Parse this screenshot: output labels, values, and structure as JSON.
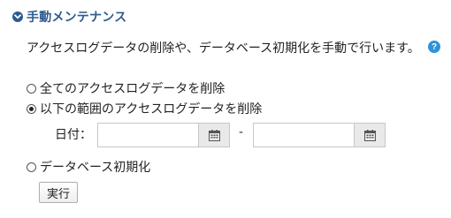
{
  "section": {
    "title": "手動メンテナンス",
    "description": "アクセスログデータの削除や、データベース初期化を手動で行います。",
    "help_label": "?"
  },
  "options": [
    {
      "label": "全てのアクセスログデータを削除",
      "checked": false
    },
    {
      "label": "以下の範囲のアクセスログデータを削除",
      "checked": true
    },
    {
      "label": "データベース初期化",
      "checked": false
    }
  ],
  "date_range": {
    "label": "日付：",
    "separator": "-",
    "from_value": "",
    "to_value": ""
  },
  "actions": {
    "execute_label": "実行"
  },
  "colors": {
    "header": "#2d5a8e",
    "help_icon": "#2f93d9",
    "calendar_button_bg": "#e9e9e9"
  }
}
